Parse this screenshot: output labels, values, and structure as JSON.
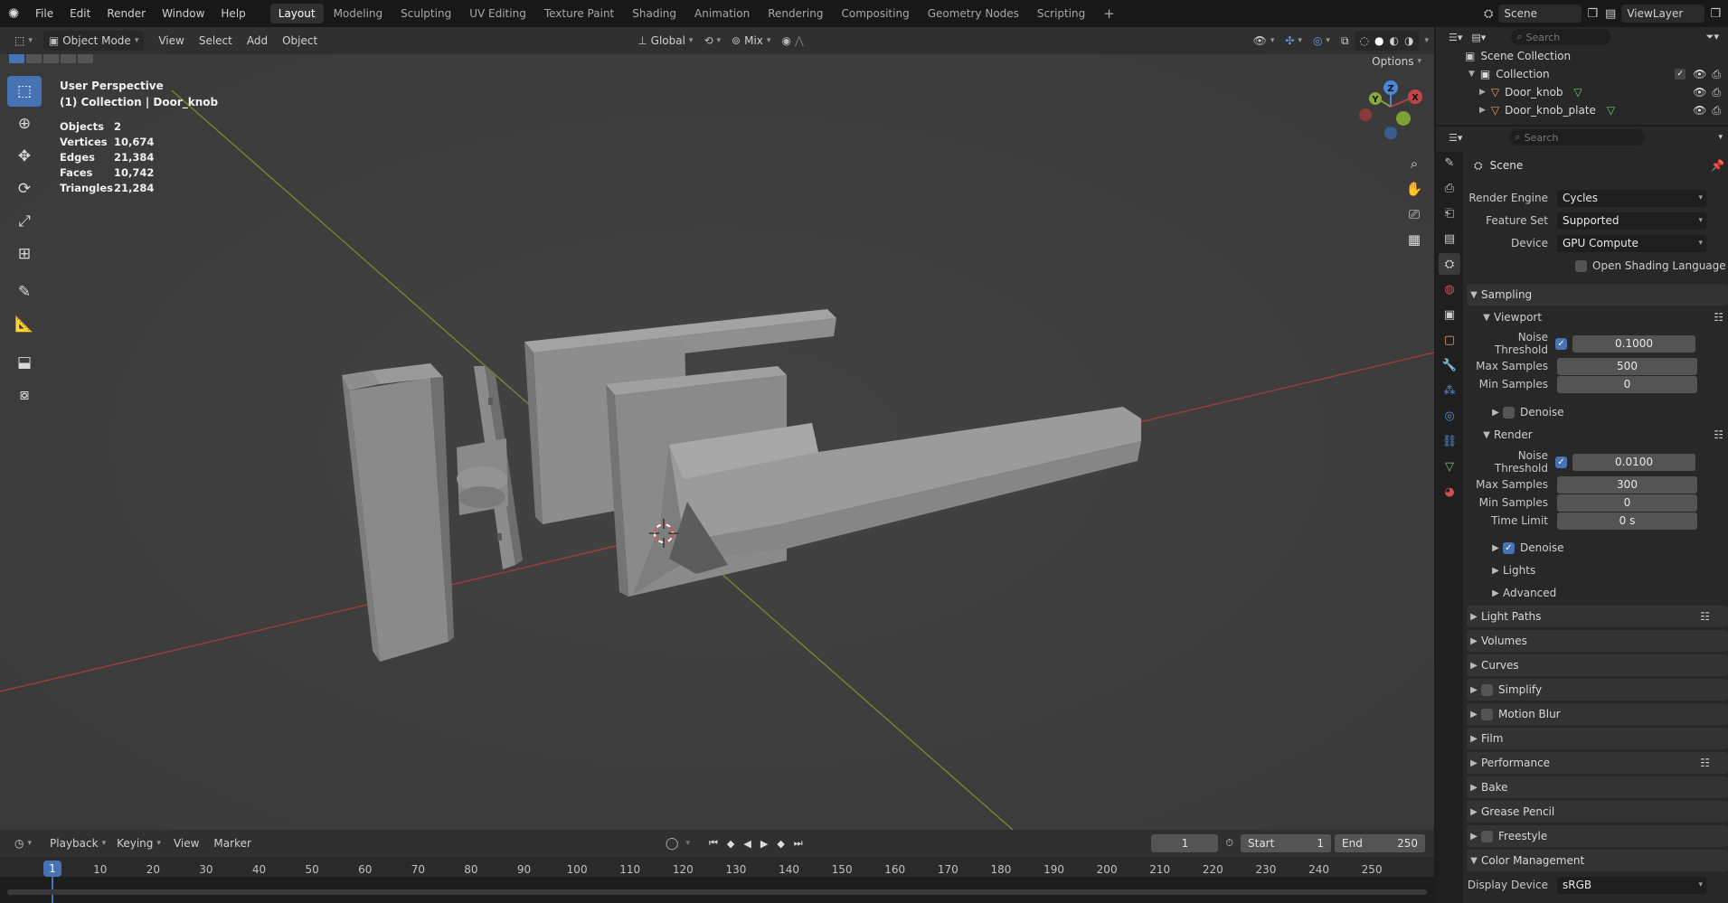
{
  "topbar": {
    "menus": [
      "File",
      "Edit",
      "Render",
      "Window",
      "Help"
    ],
    "workspaces": [
      "Layout",
      "Modeling",
      "Sculpting",
      "UV Editing",
      "Texture Paint",
      "Shading",
      "Animation",
      "Rendering",
      "Compositing",
      "Geometry Nodes",
      "Scripting"
    ],
    "active_workspace": "Layout",
    "add_tab": "+",
    "scene": "Scene",
    "view_layer": "ViewLayer"
  },
  "viewport_header": {
    "mode": "Object Mode",
    "menus": [
      "View",
      "Select",
      "Add",
      "Object"
    ],
    "orientation": "Global",
    "snap": "Mix",
    "options": "Options"
  },
  "viewport": {
    "perspective": "User Perspective",
    "context": "(1) Collection | Door_knob",
    "stats": [
      {
        "label": "Objects",
        "value": "2"
      },
      {
        "label": "Vertices",
        "value": "10,674"
      },
      {
        "label": "Edges",
        "value": "21,384"
      },
      {
        "label": "Faces",
        "value": "10,742"
      },
      {
        "label": "Triangles",
        "value": "21,284"
      }
    ],
    "gizmo": {
      "x": "X",
      "y": "Y",
      "z": "Z"
    }
  },
  "outliner": {
    "search_placeholder": "Search",
    "root": "Scene Collection",
    "collection": "Collection",
    "objects": [
      "Door_knob",
      "Door_knob_plate"
    ]
  },
  "properties": {
    "search_placeholder": "Search",
    "scene_title": "Scene",
    "render_engine": {
      "label": "Render Engine",
      "value": "Cycles"
    },
    "feature_set": {
      "label": "Feature Set",
      "value": "Supported"
    },
    "device": {
      "label": "Device",
      "value": "GPU Compute"
    },
    "osl": "Open Shading Language",
    "sampling": "Sampling",
    "viewport": {
      "title": "Viewport",
      "noise_threshold_label": "Noise Threshold",
      "noise_threshold": "0.1000",
      "max_samples_label": "Max Samples",
      "max_samples": "500",
      "min_samples_label": "Min Samples",
      "min_samples": "0",
      "denoise": "Denoise"
    },
    "render": {
      "title": "Render",
      "noise_threshold_label": "Noise Threshold",
      "noise_threshold": "0.0100",
      "max_samples_label": "Max Samples",
      "max_samples": "300",
      "min_samples_label": "Min Samples",
      "min_samples": "0",
      "time_limit_label": "Time Limit",
      "time_limit": "0 s",
      "denoise": "Denoise",
      "lights": "Lights",
      "advanced": "Advanced"
    },
    "panels": [
      "Light Paths",
      "Volumes",
      "Curves",
      "Simplify",
      "Motion Blur",
      "Film",
      "Performance",
      "Bake",
      "Grease Pencil",
      "Freestyle"
    ],
    "color_management": "Color Management",
    "display_device_label": "Display Device",
    "display_device": "sRGB"
  },
  "timeline": {
    "menus": [
      "Playback",
      "Keying",
      "View",
      "Marker"
    ],
    "current_frame": "1",
    "start_label": "Start",
    "start": "1",
    "end_label": "End",
    "end": "250",
    "ruler": [
      "1",
      "10",
      "20",
      "30",
      "40",
      "50",
      "60",
      "70",
      "80",
      "90",
      "100",
      "110",
      "120",
      "130",
      "140",
      "150",
      "160",
      "170",
      "180",
      "190",
      "200",
      "210",
      "220",
      "230",
      "240",
      "250"
    ]
  },
  "colors": {
    "accent": "#4772b3",
    "x_axis": "#b34040",
    "y_axis": "#7da037",
    "z_axis": "#4a87d6"
  }
}
